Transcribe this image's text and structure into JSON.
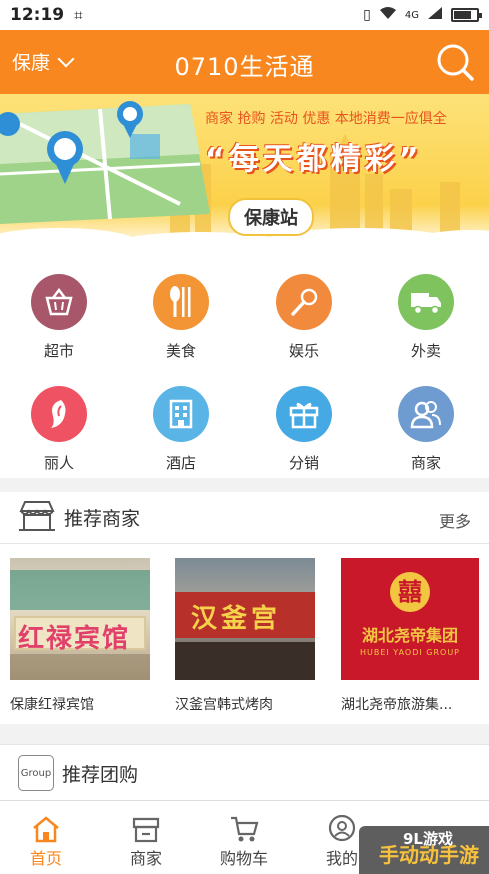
{
  "status_bar": {
    "time": "12:19",
    "network": "4G"
  },
  "header": {
    "city": "保康",
    "title": "0710生活通"
  },
  "banner": {
    "tagline": "商家 抢购 活动 优惠 本地消费一应俱全",
    "slogan": "“每天都精彩”",
    "station": "保康站"
  },
  "categories": [
    {
      "label": "超市",
      "icon": "basket-icon",
      "color": "#a8576a"
    },
    {
      "label": "美食",
      "icon": "cutlery-icon",
      "color": "#f49535"
    },
    {
      "label": "娱乐",
      "icon": "microphone-icon",
      "color": "#f28a3e"
    },
    {
      "label": "外卖",
      "icon": "delivery-truck-icon",
      "color": "#7fc35e"
    },
    {
      "label": "丽人",
      "icon": "lady-icon",
      "color": "#ef5262"
    },
    {
      "label": "酒店",
      "icon": "hotel-icon",
      "color": "#5ab4e6"
    },
    {
      "label": "分销",
      "icon": "gift-icon",
      "color": "#45a9e4"
    },
    {
      "label": "商家",
      "icon": "users-icon",
      "color": "#6e9bd0"
    }
  ],
  "merchants_section": {
    "title": "推荐商家",
    "more": "更多",
    "items": [
      {
        "name": "保康红禄宾馆",
        "sign_text": "红禄宾馆"
      },
      {
        "name": "汉釜宫韩式烤肉",
        "sign_text": "汉釜宫"
      },
      {
        "name": "湖北尧帝旅游集...",
        "sign_text": "湖北尧帝集团",
        "sign_sub": "HUBEI YAODI GROUP"
      }
    ]
  },
  "group_section": {
    "title": "推荐团购",
    "badge": "Group"
  },
  "bottom_nav": [
    {
      "label": "首页",
      "icon": "home-icon",
      "active": true
    },
    {
      "label": "商家",
      "icon": "store-icon",
      "active": false
    },
    {
      "label": "购物车",
      "icon": "cart-icon",
      "active": false
    },
    {
      "label": "我的",
      "icon": "profile-icon",
      "active": false
    }
  ],
  "watermark": {
    "text": "手动动手游",
    "top": "9L游戏"
  },
  "colors": {
    "brand": "#f7871e",
    "active_nav": "#f7871e"
  }
}
